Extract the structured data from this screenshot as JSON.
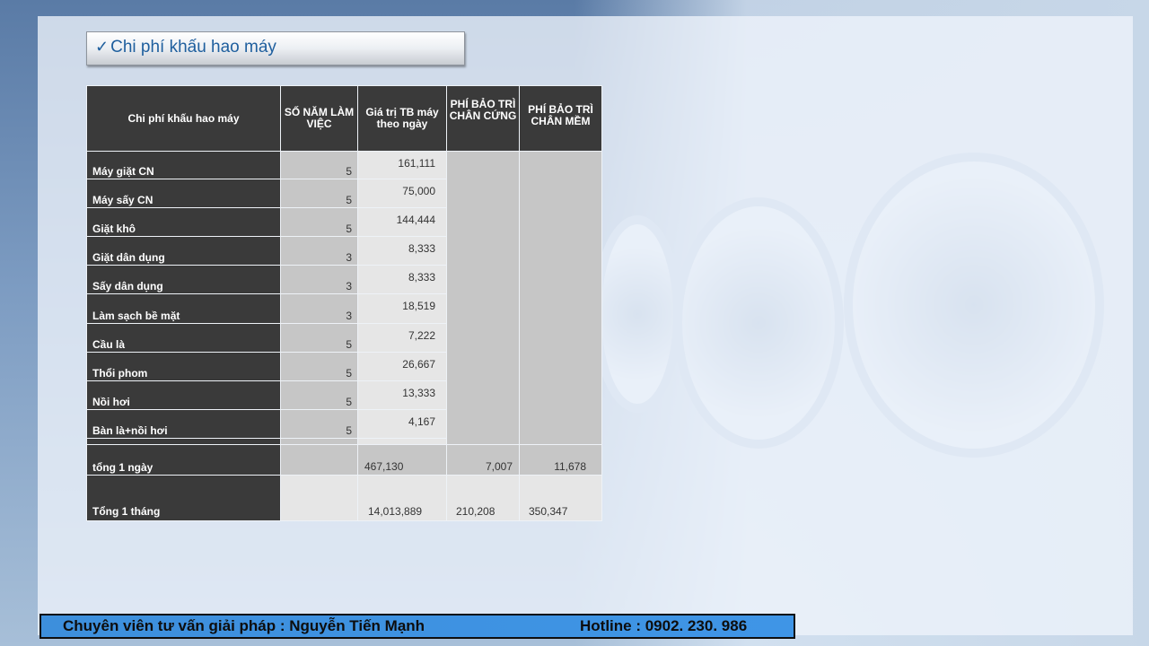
{
  "title": {
    "check": "✓",
    "text": "Chi phí  khấu hao máy"
  },
  "headers": {
    "col1": "Chi  phí khấu hao máy",
    "col2": "SỐ NĂM LÀM VIỆC",
    "col3": "Giá  trị TB máy theo ngày",
    "col4": "PHÍ BẢO TRÌ CHÂN CỨNG",
    "col5": "PHÍ BẢO TRÌ CHÂN  MỀM"
  },
  "rows": [
    {
      "label": "Máy giặt CN",
      "years": "5",
      "value": "161,111"
    },
    {
      "label": "Máy sấy  CN",
      "years": "5",
      "value": "75,000"
    },
    {
      "label": "Giặt khô",
      "years": "5",
      "value": "144,444"
    },
    {
      "label": "Giặt dân dụng",
      "years": "3",
      "value": "8,333"
    },
    {
      "label": " Sấy dân dụng",
      "years": "3",
      "value": "8,333"
    },
    {
      "label": "Làm sạch  bề mặt",
      "years": "3",
      "value": "18,519"
    },
    {
      "label": "Cầu là",
      "years": "5",
      "value": "7,222"
    },
    {
      "label": "Thổi phom",
      "years": "5",
      "value": "26,667"
    },
    {
      "label": "Nồi hơi",
      "years": "5",
      "value": "13,333"
    },
    {
      "label": "Bàn là+nồi hơi",
      "years": "5",
      "value": "4,167"
    }
  ],
  "total_day": {
    "label": "tổng 1 ngày",
    "value": "467,130",
    "hard": "7,007",
    "soft": "11,678"
  },
  "total_month": {
    "label": "Tổng 1 tháng",
    "value": "14,013,889",
    "hard": "210,208",
    "soft": "350,347"
  },
  "footer": {
    "consultant": "Chuyên viên tư vấn giải pháp : Nguyễn Tiến Mạnh",
    "hotline": "Hotline : 0902. 230. 986"
  },
  "colors": {
    "header_bg": "#3a3a3a",
    "title_text": "#1f5f9e",
    "footer_bg": "#3f95e6"
  }
}
